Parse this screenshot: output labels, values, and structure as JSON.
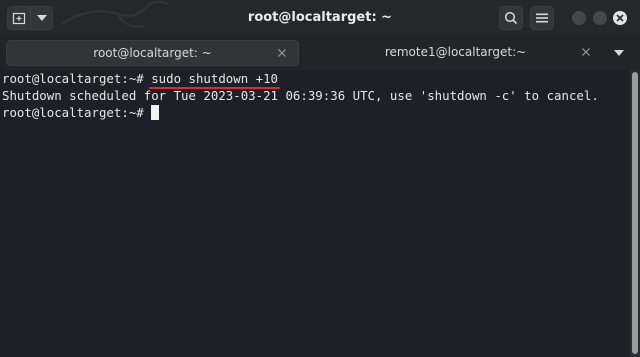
{
  "window": {
    "title": "root@localtarget: ~"
  },
  "header": {
    "icons": {
      "new_tab": "new-tab-icon",
      "dropdown": "chevron-down-icon",
      "search": "search-icon",
      "menu": "hamburger-menu-icon",
      "close": "close-icon"
    }
  },
  "tabs": [
    {
      "label": "root@localtarget: ~",
      "active": true
    },
    {
      "label": "remote1@localtarget:~",
      "active": false
    }
  ],
  "terminal": {
    "lines": [
      {
        "prompt": "root@localtarget:~# ",
        "command": "sudo shutdown +10"
      },
      {
        "output": "Shutdown scheduled for Tue 2023-03-21 06:39:36 UTC, use 'shutdown -c' to cancel."
      },
      {
        "prompt": "root@localtarget:~# ",
        "command": ""
      }
    ]
  },
  "colors": {
    "background": "#1e1f29",
    "header": "#26272e",
    "text": "#e6e6e6",
    "highlight_underline": "#e8262b"
  }
}
